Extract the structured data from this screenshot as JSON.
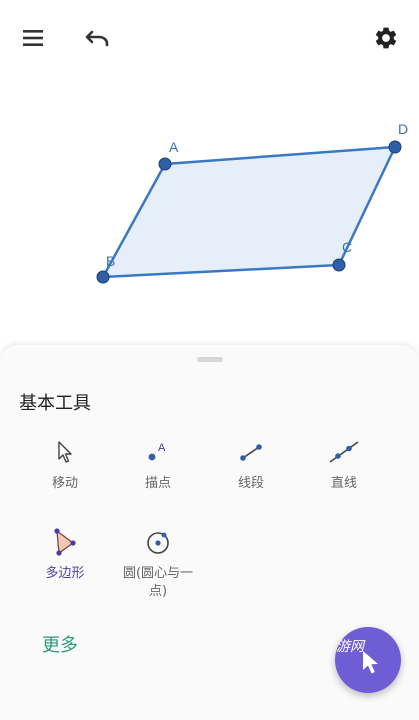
{
  "toolbar": {
    "menu_icon": "hamburger-menu-icon",
    "undo_icon": "undo-icon",
    "settings_icon": "gear-icon"
  },
  "canvas": {
    "shape_fill": "#e6eefa",
    "shape_stroke": "#3a78c3",
    "points": [
      {
        "label": "A"
      },
      {
        "label": "B"
      },
      {
        "label": "C"
      },
      {
        "label": "D"
      }
    ]
  },
  "tools_panel": {
    "title": "基本工具",
    "tools": [
      {
        "label": "移动",
        "icon": "pointer-arrow-icon",
        "active": false
      },
      {
        "label": "描点",
        "icon": "point-icon",
        "active": false
      },
      {
        "label": "线段",
        "icon": "segment-icon",
        "active": false
      },
      {
        "label": "直线",
        "icon": "line-icon",
        "active": false
      },
      {
        "label": "多边形",
        "icon": "polygon-icon",
        "active": true
      },
      {
        "label": "圆(圆心与一点)",
        "label_line1": "圆(圆心与一",
        "label_line2": "点)",
        "icon": "circle-center-point-icon",
        "active": false
      }
    ],
    "more_label": "更多"
  },
  "fab": {
    "icon": "cursor-icon",
    "color": "#6f5dd6"
  },
  "watermark": {
    "text": "游网"
  }
}
